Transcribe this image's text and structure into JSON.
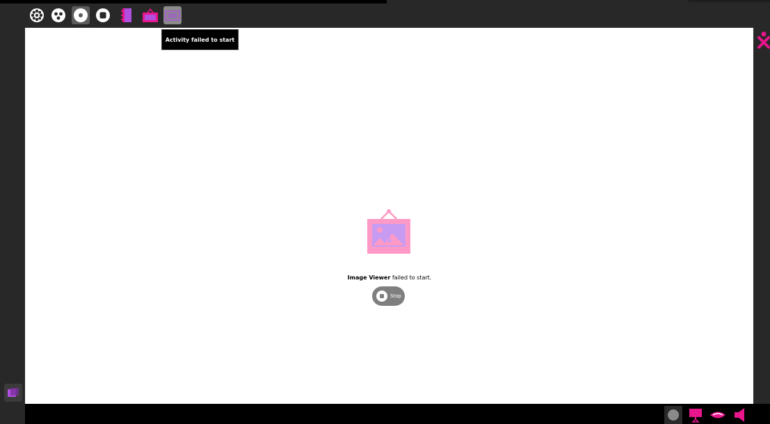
{
  "toolbar": {
    "icons": [
      "neighborhood-icon",
      "group-icon",
      "home-icon",
      "activity-icon",
      "journal-icon",
      "image-viewer-icon",
      "failed-activity-icon"
    ]
  },
  "tooltip": {
    "text": "Activity failed to start"
  },
  "error": {
    "activity_name": "Image Viewer",
    "message_suffix": " failed to start.",
    "stop_label": "Stop"
  },
  "colors": {
    "accent_magenta": "#e8158c",
    "accent_purple": "#b04fe0",
    "icon_pink": "#ff9ac6",
    "icon_lilac": "#c79bf2"
  }
}
